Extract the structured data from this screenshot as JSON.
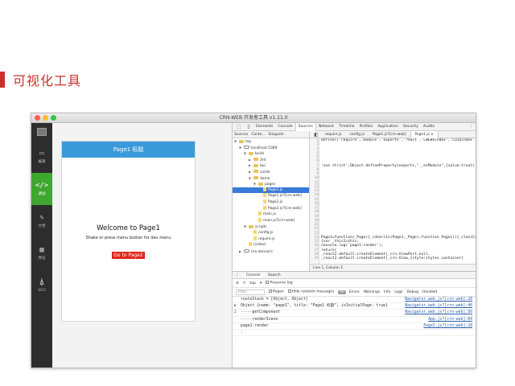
{
  "slide": {
    "title": "可视化工具"
  },
  "window": {
    "title": "CRN-WEB 开发者工具 v1.11.0"
  },
  "left_nav": [
    {
      "icon": "▭",
      "label": "编辑",
      "active": false
    },
    {
      "icon": "</>",
      "label": "调试",
      "active": true
    },
    {
      "icon": "✎",
      "label": "文档",
      "active": false
    },
    {
      "icon": "▦",
      "label": "预览",
      "active": false
    },
    {
      "icon": "⍋",
      "label": "SEO",
      "active": false
    }
  ],
  "phone": {
    "header_title": "Page1 标题",
    "welcome": "Welcome to Page1",
    "hint": "Shake or press menu button for dev menu",
    "goto_label": "Go to Page2"
  },
  "devtools": {
    "tabs": [
      "Elements",
      "Console",
      "Sources",
      "Network",
      "Timeline",
      "Profiles",
      "Application",
      "Security",
      "Audits"
    ],
    "selected_tab": "Sources",
    "nav_subtabs": [
      "Sources",
      "Conte...",
      "Snippets"
    ],
    "tree": [
      {
        "depth": 0,
        "label": "top",
        "kind": "folder",
        "open": true
      },
      {
        "depth": 1,
        "label": "localhost:5389",
        "kind": "cloud",
        "open": true
      },
      {
        "depth": 2,
        "label": "build",
        "kind": "folder",
        "open": true
      },
      {
        "depth": 3,
        "label": "3rd",
        "kind": "folder",
        "open": false
      },
      {
        "depth": 3,
        "label": "bui",
        "kind": "folder",
        "open": false
      },
      {
        "depth": 3,
        "label": "comb",
        "kind": "folder",
        "open": false
      },
      {
        "depth": 3,
        "label": "demo",
        "kind": "folder",
        "open": true
      },
      {
        "depth": 4,
        "label": "pages",
        "kind": "folder",
        "open": true
      },
      {
        "depth": 5,
        "label": "Page1.js",
        "kind": "file",
        "selected": true
      },
      {
        "depth": 5,
        "label": "Page1.js?[crn-web]",
        "kind": "file"
      },
      {
        "depth": 5,
        "label": "Page2.js",
        "kind": "file"
      },
      {
        "depth": 5,
        "label": "Page2.js?[crn-web]",
        "kind": "file"
      },
      {
        "depth": 4,
        "label": "main.js",
        "kind": "file"
      },
      {
        "depth": 4,
        "label": "main.js?[crn-web]",
        "kind": "file"
      },
      {
        "depth": 2,
        "label": "scripts",
        "kind": "folder",
        "open": true
      },
      {
        "depth": 3,
        "label": "config.js",
        "kind": "file"
      },
      {
        "depth": 3,
        "label": "require.js",
        "kind": "file"
      },
      {
        "depth": 2,
        "label": "(index)",
        "kind": "file"
      },
      {
        "depth": 1,
        "label": "(no domain)",
        "kind": "cloud",
        "open": false
      }
    ],
    "file_tabs": [
      "require.js",
      "config.js",
      "Page1.js?[crn-web]",
      "Page1.js ×"
    ],
    "selected_file_tab": "Page1.js ×",
    "code_lines": [
      "define(['require','module','exports','react','CWEB$index','CUI$index'],f",
      "",
      "",
      "",
      "",
      "",
      "'use strict';Object.defineProperty(exports,\"__esModule\",{value:true});ex",
      "",
      "",
      "",
      "",
      "",
      "",
      "",
      "",
      "",
      "",
      "",
      "",
      "",
      "",
      "",
      "",
      "Page1=function(_Page){_inherits(Page1,_Page);function Page1(){_classCall",
      "{var _this2=this;",
      "console.log('page1:render');",
      "return(",
      "_react2.default.createElement(_crn.ViewPort,null,",
      "_react2.default.createElement(_crn.View,{style:styles.container}"
    ],
    "editor_status": "Line 1, Column 1",
    "console": {
      "tabs": [
        "Console",
        "Search"
      ],
      "context": "top",
      "preserve_log": "Preserve log",
      "filter_placeholder": "Filter",
      "regex": "Regex",
      "hide_network": "Hide network messages",
      "levels": [
        "All",
        "Errors",
        "Warnings",
        "Info",
        "Logs",
        "Debug",
        "Handled"
      ],
      "lines": [
        {
          "marker": "",
          "text": "routeStack = [Object, Object]",
          "source": "Navigator.web.js?[crn-web]:28"
        },
        {
          "marker": "▶",
          "text": "Object {name: \"page1\", title: \"Page1 标题\", isInitialPage: true}",
          "source": "Navigator.web.js?[crn-web]:40"
        },
        {
          "marker": "2",
          "text": "-----getComponent",
          "source": "Navigator.web.js?[crn-web]:56"
        },
        {
          "marker": "",
          "text": "-----renderScene",
          "source": "App.js?[crn-web]:84"
        },
        {
          "marker": "",
          "text": "page1:render",
          "source": "Page1.js?[crn-web]:28"
        }
      ],
      "prompt": "›"
    }
  }
}
